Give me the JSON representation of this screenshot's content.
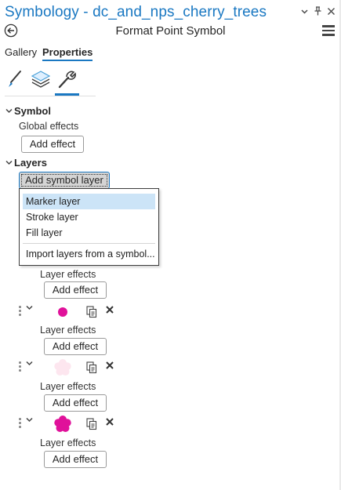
{
  "window": {
    "title": "Symbology - dc_and_nps_cherry_trees",
    "controls": {
      "pin": "⌄",
      "autohide": "ᛘ",
      "close": "✕"
    }
  },
  "header": {
    "subtitle": "Format Point Symbol",
    "back_icon": "back-arrow-icon",
    "menu_icon": "hamburger-menu-icon"
  },
  "tabs": [
    {
      "label": "Gallery"
    },
    {
      "label": "Properties"
    }
  ],
  "icon_tabs": [
    {
      "icon": "brush-icon"
    },
    {
      "icon": "layers-icon"
    },
    {
      "icon": "wrench-icon"
    }
  ],
  "symbol_section": {
    "title": "Symbol",
    "global_effects_label": "Global effects",
    "add_effect_label": "Add effect"
  },
  "layers_section": {
    "title": "Layers",
    "add_symbol_layer_label": "Add symbol layer"
  },
  "dropdown": {
    "items": [
      {
        "label": "Marker layer"
      },
      {
        "label": "Stroke layer"
      },
      {
        "label": "Fill layer"
      },
      {
        "label": "Import layers from a symbol..."
      }
    ]
  },
  "first_layer": {
    "effects_label": "Layer effects",
    "add_effect_label": "Add effect"
  },
  "layers": [
    {
      "swatch_color": "#e0119a",
      "shape": "circle",
      "effects_label": "Layer effects",
      "add_effect_label": "Add effect"
    },
    {
      "swatch_color": "#fde6ef",
      "shape": "flower",
      "effects_label": "Layer effects",
      "add_effect_label": "Add effect"
    },
    {
      "swatch_color": "#e0119a",
      "shape": "flower",
      "effects_label": "Layer effects",
      "add_effect_label": "Add effect"
    }
  ],
  "colors": {
    "accent": "#1a78c2",
    "hover": "#cce4f7",
    "magenta": "#e0119a",
    "pale_pink": "#fde6ef"
  }
}
